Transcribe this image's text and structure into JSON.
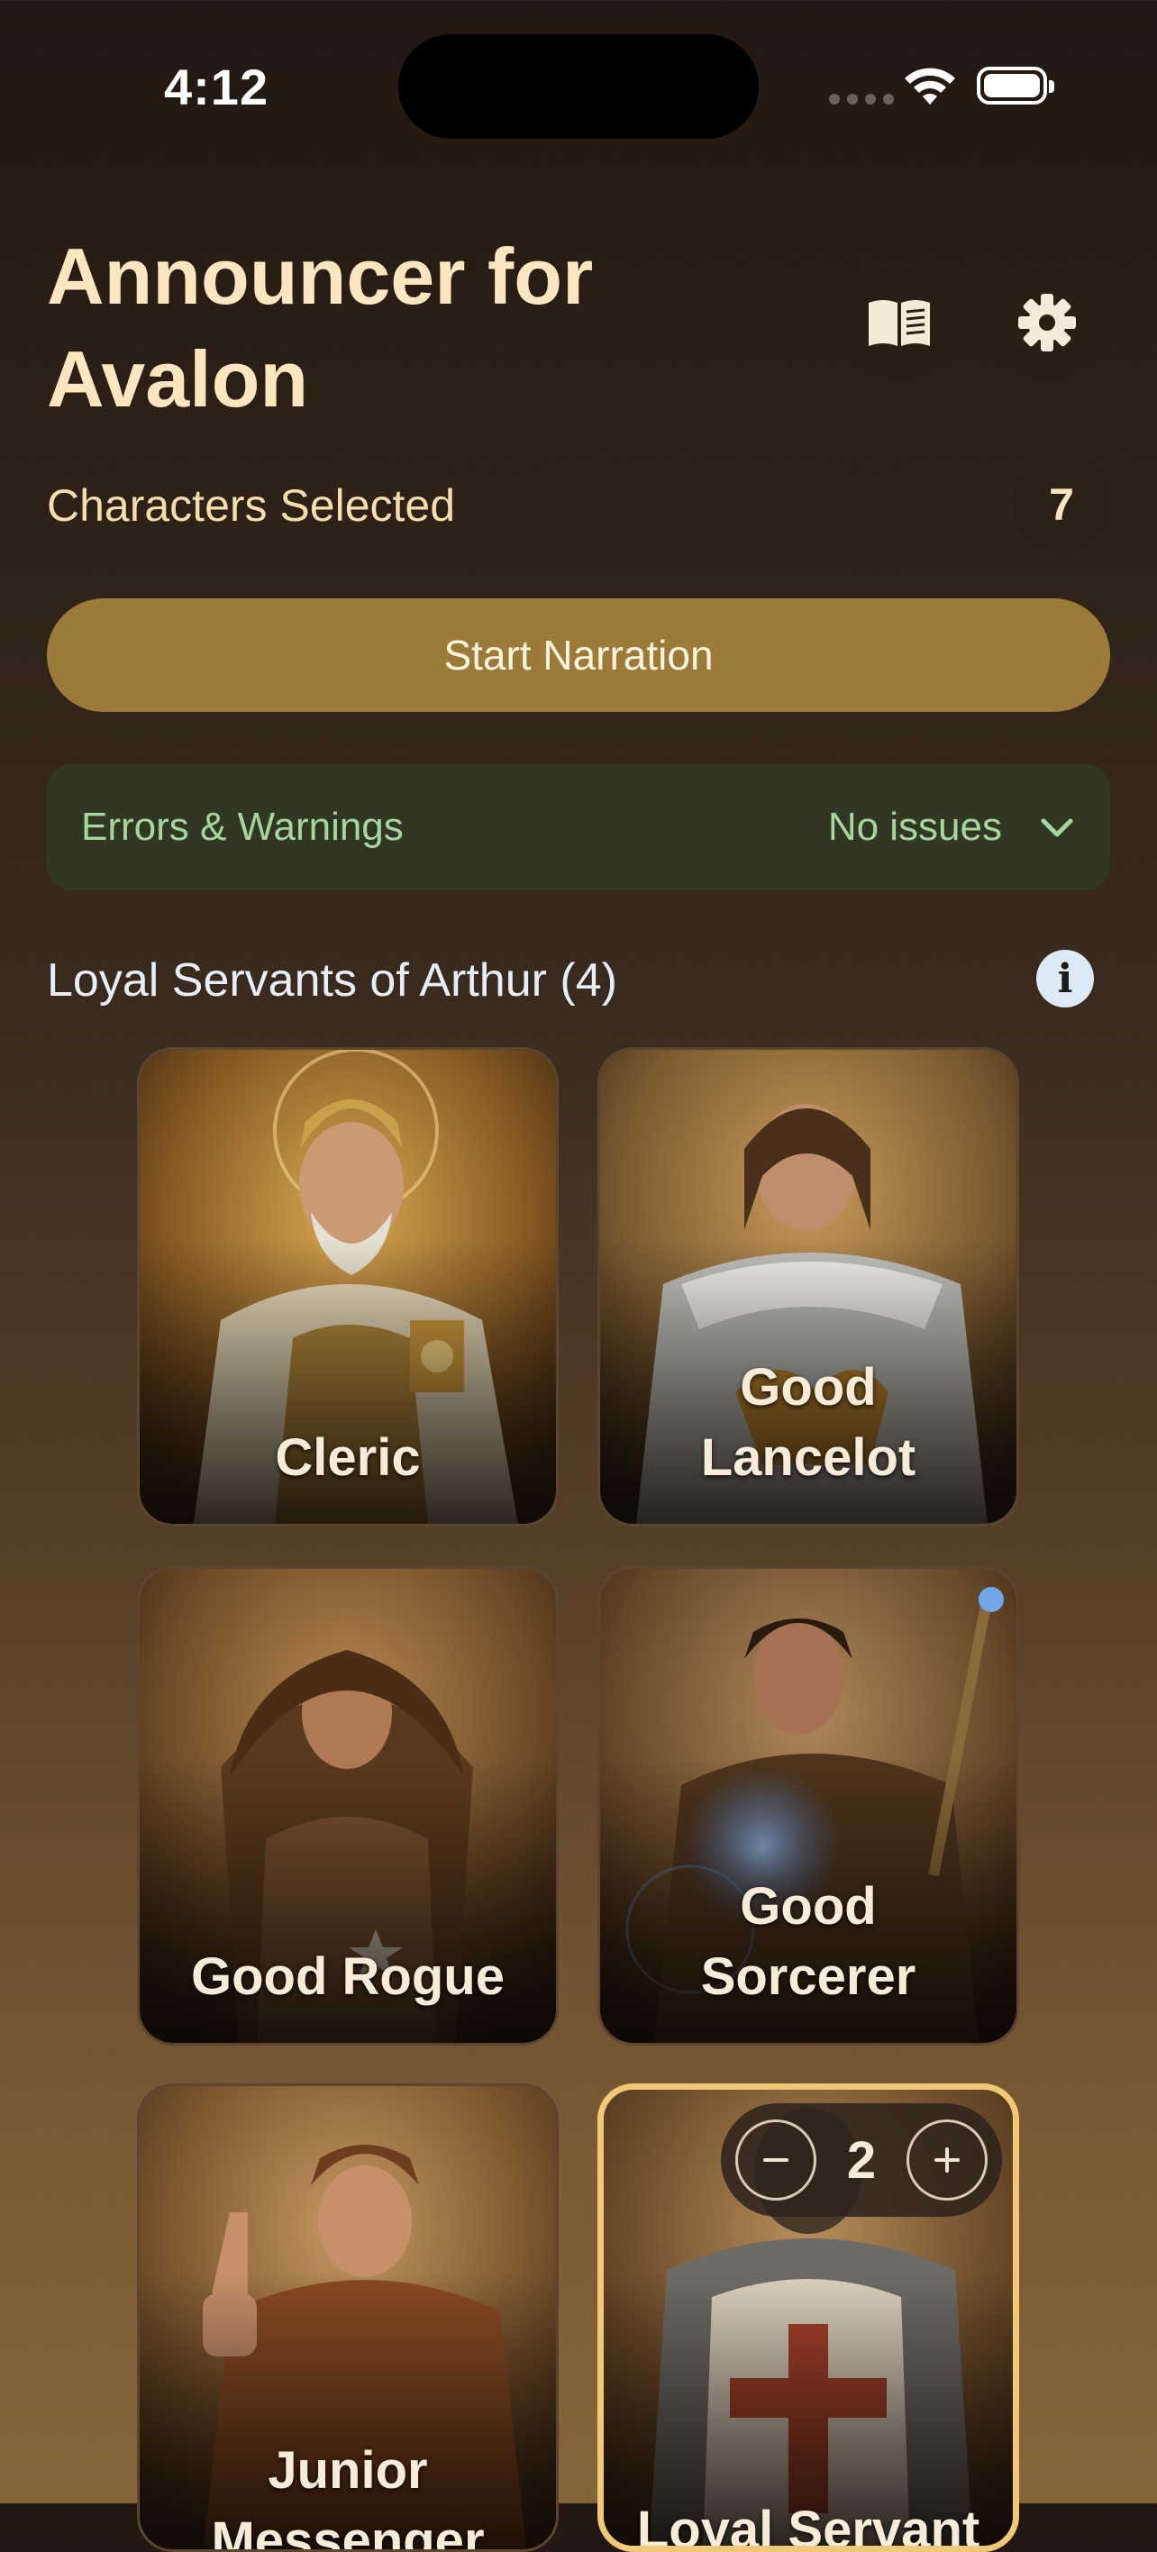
{
  "status_bar": {
    "time": "4:12"
  },
  "header": {
    "title_line1": "Announcer for",
    "title_line2": "Avalon",
    "rules_icon": "book-icon",
    "settings_icon": "gear-icon"
  },
  "selection": {
    "label": "Characters Selected",
    "count": "7"
  },
  "start_button": {
    "label": "Start Narration"
  },
  "errors": {
    "label": "Errors & Warnings",
    "status": "No issues"
  },
  "section": {
    "title": "Loyal Servants of Arthur (4)",
    "info_icon": "info-icon"
  },
  "cards": [
    {
      "name": "Cleric"
    },
    {
      "name": "Good\nLancelot"
    },
    {
      "name": "Good Rogue"
    },
    {
      "name": "Good\nSorcerer"
    },
    {
      "name": "Junior\nMessenger"
    },
    {
      "name": "Loyal Servant",
      "quantity": "2"
    }
  ],
  "colors": {
    "accent": "#9b7a3a",
    "selected_border": "#f0c878",
    "ok_text": "#a6d69d"
  }
}
